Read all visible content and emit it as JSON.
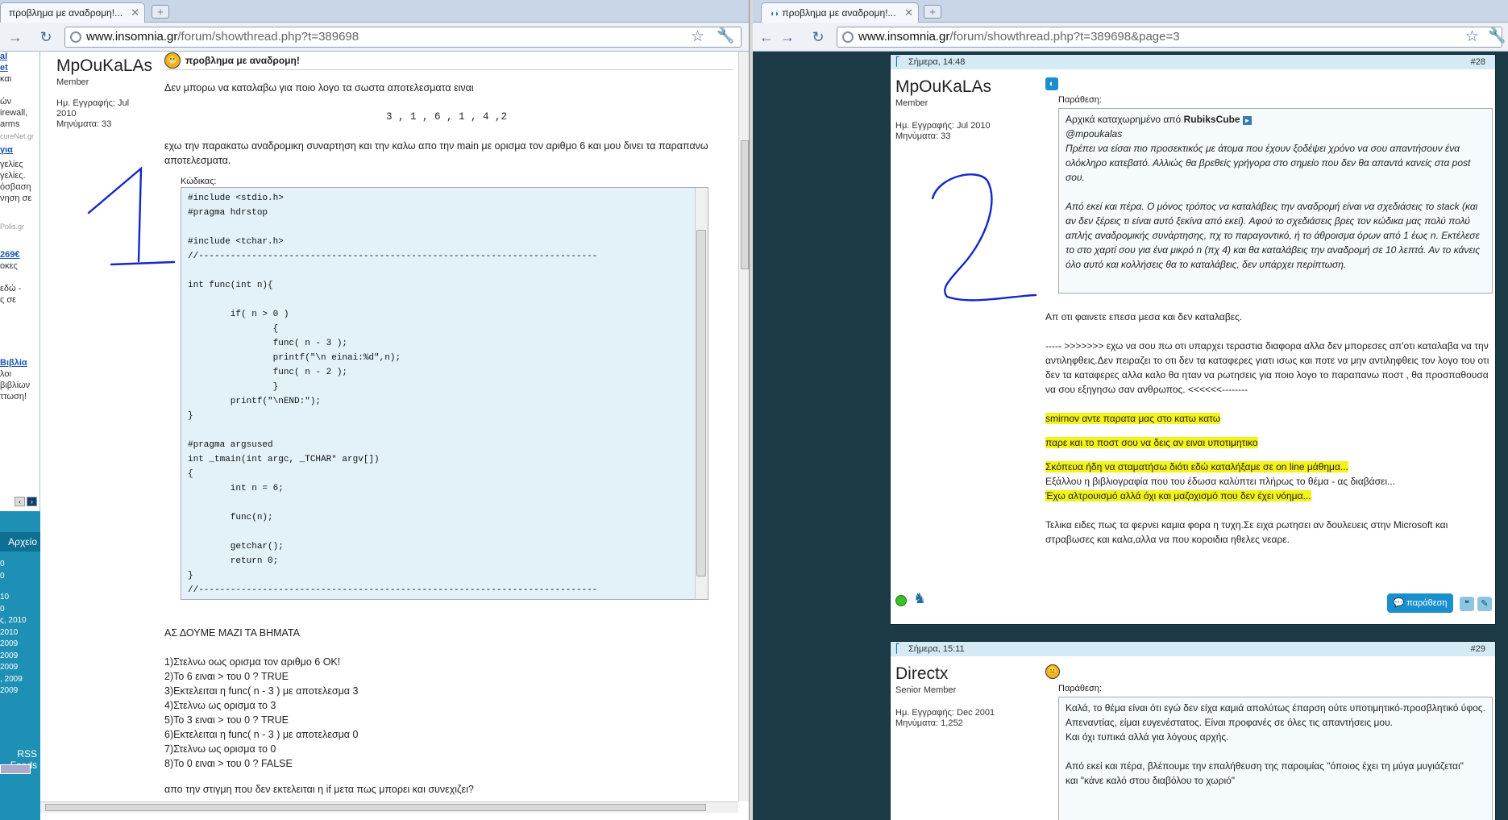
{
  "left_window": {
    "tab_title": "προβλημα με αναδρομη!...",
    "url_host": "www.insomnia.gr",
    "url_path": "/forum/showthread.php?t=389698",
    "sidebar": {
      "lines": [
        {
          "t": "al",
          "link": true
        },
        {
          "t": "et",
          "link": true
        },
        {
          "t": "και",
          "link": false
        },
        {
          "t": "ών",
          "link": false
        },
        {
          "t": "irewall,",
          "link": false
        },
        {
          "t": "arms",
          "link": false
        },
        {
          "t": "cureNet.gr",
          "link": false,
          "faint": true
        },
        {
          "t": "για",
          "link": true
        },
        {
          "t": "γελίες",
          "link": false
        },
        {
          "t": "γελίες.",
          "link": false
        },
        {
          "t": "όσβαση",
          "link": false
        },
        {
          "t": "νηση σε",
          "link": false
        },
        {
          "t": "Polis.gr",
          "link": false,
          "faint": true
        },
        {
          "t": "269€",
          "link": true
        },
        {
          "t": "οκες",
          "link": false
        },
        {
          "t": "εδώ -",
          "link": false
        },
        {
          "t": "ς σε",
          "link": false
        },
        {
          "t": "Βιβλία",
          "link": true
        },
        {
          "t": "λοι",
          "link": false
        },
        {
          "t": "βιβλίων",
          "link": false
        },
        {
          "t": "ττωση!",
          "link": false
        }
      ],
      "archive_label": "Αρχείο",
      "archive_items": [
        "0",
        "0",
        "10",
        "0",
        "ς, 2010",
        "2010",
        "2009",
        "2009",
        "2009",
        ", 2009",
        "2009"
      ],
      "rss_label": "RSS Feeds"
    },
    "post": {
      "username": "MpOuKaLAs",
      "role": "Member",
      "reg": "Ημ. Εγγραφής: Jul 2010",
      "messages": "Μηνύματα: 33",
      "title": "προβλημα με αναδρομη!",
      "intro": "Δεν μπορω να καταλαβω για ποιο λογο τα σωστα αποτελεσματα ειναι",
      "result": "3 , 1 , 6 , 1 , 4 ,2",
      "desc": "εχω την παρακατω αναδρομικη συναρτηση και την καλω απο την main με ορισμα τον αριθμο 6 και μου δινει τα παραπανω αποτελεσματα.",
      "code_label": "Κώδικας:",
      "code": "#include <stdio.h>\n#pragma hdrstop\n\n#include <tchar.h>\n//---------------------------------------------------------------------------\n\nint func(int n){\n\n        if( n > 0 )\n                {\n                func( n - 3 );\n                printf(\"\\n einai:%d\",n);\n                func( n - 2 );\n                }\n        printf(\"\\nEND:\");\n}\n\n#pragma argsused\nint _tmain(int argc, _TCHAR* argv[])\n{\n        int n = 6;\n\n        func(n);\n\n        getchar();\n        return 0;\n}\n//---------------------------------------------------------------------------",
      "steps_title": "ΑΣ ΔΟΥΜΕ ΜΑΖΙ ΤΑ ΒΗΜΑΤΑ",
      "steps": [
        "1)Στελνω οως ορισμα τον αριθμο 6 OK!",
        "2)Το 6 ειναι > του 0 ? TRUE",
        "3)Εκτελειται η func( n - 3 ) με αποτελεσμα 3",
        "4)Στελνω ως ορισμα το 3",
        "5)Το 3 ειναι > του 0 ? TRUE",
        "6)Εκτελειται η func( n - 3 ) με αποτελεσμα 0",
        "7)Στελνω ως ορισμα το 0",
        "8)Το 0 ειναι > του 0 ? FALSE"
      ],
      "outro": "απο την στιγμη που δεν εκτελειται η if μετα πως μπορει και συνεχιζει?"
    },
    "annotation": "1"
  },
  "right_window": {
    "tab_title": "προβλημα με αναδρομη!...",
    "url_host": "www.insomnia.gr",
    "url_path": "/forum/showthread.php?t=389698&page=3",
    "post28": {
      "date": "Σήμερα, 14:48",
      "num": "#28",
      "username": "MpOuKaLAs",
      "role": "Member",
      "reg": "Ημ. Εγγραφής: Jul 2010",
      "messages": "Μηνύματα: 33",
      "quote_label": "Παράθεση:",
      "quote_origin_prefix": "Αρχικά καταχωρημένο από",
      "quote_author": "RubiksCube",
      "quote_lines": [
        "@mpoukalas",
        "Πρέπει να είσαι πιο προσεκτικός με άτομα που έχουν ξοδέψει χρόνο να σου απαντήσουν ένα ολόκληρο κατεβατό. Αλλιώς θα βρεθείς γρήγορα στο σημείο που δεν θα απαντά κανείς στα post σου.",
        "Από εκεί και πέρα. Ο μόνος τρόπος να καταλάβεις την αναδρομή είναι να σχεδιάσεις το stack (και αν δεν ξέρεις τι είναι αυτό ξεκίνα από εκεί). Αφού το σχεδιάσεις βρες τον κώδικα μας πολύ πολύ απλής αναδρομικής συνάρτησης, πχ το παραγοντικό, ή το άθροισμα όρων από 1 έως n. Εκτέλεσε το στο χαρτί σου για ένα μικρό n (πχ 4) και θα καταλάβεις την αναδρομή σε 10 λεπτά. Αν το κάνεις όλο αυτό και κολλήσεις θα το καταλάβεις, δεν υπάρχει περίπτωση."
      ],
      "p1": "Απ οτι φαινετε επεσα μεσα και δεν καταλαβες.",
      "p2": "----- >>>>>>> εχω να σου πω οτι υπαρχει τεραστια διαφορα αλλα δεν μπορεσες απ'οτι καταλαβα να την αντιληφθεις.Δεν πειραζει το οτι δεν τα καταφερες γιατι ισως και ποτε να μην αντιληφθεις τον λογο του οτι δεν τα καταφερες αλλα καλο θα ηταν να ρωτησεις για ποιο λογο το παραπανω ποστ , θα προσπαθουσα να σου εξηγησω σαν ανθρωπος. <<<<<<--------",
      "h1": "smirnov αντε παρατα μας στο κατω κατω",
      "h2": "παρε και το ποστ σου να δεις αν ειναι υποτιμητικο",
      "h3": "Σκόπευα ήδη να σταματήσω διότι εδώ καταλήξαμε σε on line μάθημα...",
      "h4": "Εξάλλου η βιβλιογραφία που του έδωσα καλύπτει πλήρως το θέμα - ας διαβάσει...",
      "h5": "Έχω αλτρουισμό αλλά όχι και μαζοχισμό που δεν έχει νόημα...",
      "p3": "Τελικα ειδες πως τα φερνει καμια φορα η τυχη.Σε ειχα ρωτησει αν δουλευεις στην Microsoft και στραβωσες και καλα,αλλα να που κοροιδια ηθελες νεαρε.",
      "quote_button": "παράθεση"
    },
    "post29": {
      "date": "Σήμερα, 15:11",
      "num": "#29",
      "username": "Directx",
      "role": "Senior Member",
      "reg": "Ημ. Εγγραφής: Dec 2001",
      "messages": "Μηνύματα: 1,252",
      "quote_label": "Παράθεση:",
      "quote_lines": [
        "Καλά, το θέμα είναι ότι εγώ δεν είχα καμιά απολύτως έπαρση ούτε υποτιμητικό-προσβλητικό ύφος.",
        "Απεναντίας, είμαι ευγενέστατος. Είναι προφανές σε όλες τις απαντήσεις μου.",
        "Και όχι τυπικά αλλά για λόγους αρχής.",
        "Από εκεί και πέρα, βλέπουμε την επαλήθευση της παροιμίας \"όποιος έχει τη μύγα μυγιάζεται\"",
        "και \"κάνε καλό στου διαβόλου το χωριό\""
      ]
    },
    "annotation": "2"
  },
  "colors": {
    "sidebar_blue": "#1e8fb5",
    "right_bg": "#1b3a45",
    "highlight": "#f3f21a",
    "ink_blue": "#1428c8"
  }
}
